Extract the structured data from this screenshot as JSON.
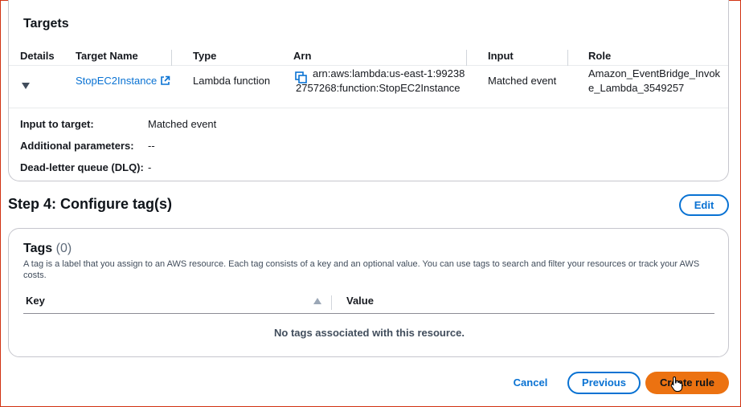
{
  "targets": {
    "title": "Targets",
    "columns": [
      "Details",
      "Target Name",
      "Type",
      "Arn",
      "Input",
      "Role"
    ],
    "row": {
      "target_name": "StopEC2Instance",
      "type": "Lambda function",
      "arn_line1": "arn:aws:lambda:us-east-1:99238",
      "arn_line2": "2757268:function:StopEC2Instance",
      "input": "Matched event",
      "role_line1": "Amazon_EventBridge_Invok",
      "role_line2": "e_Lambda_3549257"
    },
    "details": [
      {
        "label": "Input to target:",
        "value": "Matched event"
      },
      {
        "label": "Additional parameters:",
        "value": "--"
      },
      {
        "label": "Dead-letter queue (DLQ):",
        "value": "-"
      }
    ]
  },
  "step4": {
    "title": "Step 4: Configure tag(s)",
    "edit_label": "Edit"
  },
  "tags": {
    "title": "Tags",
    "count": "(0)",
    "description": "A tag is a label that you assign to an AWS resource. Each tag consists of a key and an optional value. You can use tags to search and filter your resources or track your AWS costs.",
    "columns": [
      "Key",
      "Value"
    ],
    "empty_message": "No tags associated with this resource."
  },
  "footer": {
    "cancel_label": "Cancel",
    "previous_label": "Previous",
    "create_label": "Create rule"
  },
  "colors": {
    "link": "#0972d3",
    "primary_button": "#ec7211",
    "frame": "#d13212"
  },
  "icons": [
    "external-link-icon",
    "copy-icon",
    "caret-down-icon",
    "sort-icon",
    "hand-cursor-icon"
  ]
}
